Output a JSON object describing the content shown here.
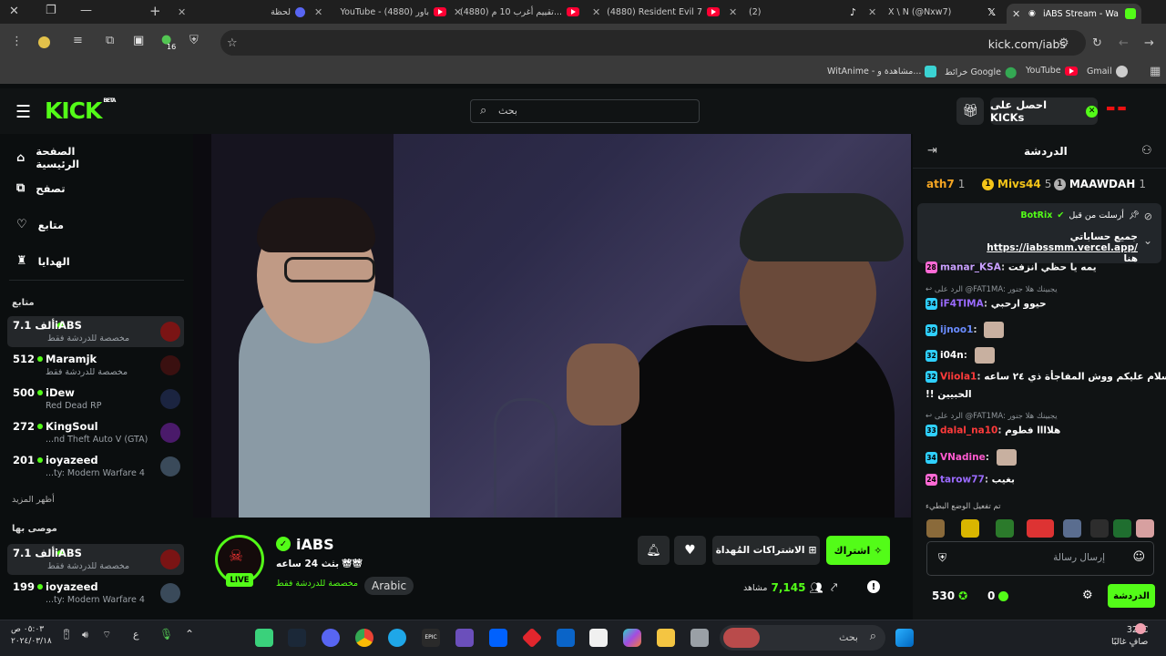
{
  "browser": {
    "tabs": [
      {
        "title": "لحظة",
        "icon": "discord-icon"
      },
      {
        "title": "YouTube - باور (4880)",
        "icon": "youtube-icon"
      },
      {
        "title": "(4880) تقييم أغرب 10 م...",
        "icon": "youtube-icon"
      },
      {
        "title": "(4880) Resident Evil 7",
        "icon": "youtube-icon"
      },
      {
        "title": "(2)",
        "icon": "tiktok-icon"
      },
      {
        "title": "X \\ N (@Nxw7)",
        "icon": "x-icon"
      },
      {
        "title": "iABS Stream - Wa",
        "icon": "kick-icon"
      }
    ],
    "url": "kick.com/iabs",
    "extension_badge": "16",
    "bookmarks": [
      {
        "label": "Gmail",
        "icon": "chrome-icon"
      },
      {
        "label": "YouTube",
        "icon": "youtube-icon"
      },
      {
        "label": "خرائط Google",
        "icon": "maps-icon"
      },
      {
        "label": "WitAnime - مشاهدة و...",
        "icon": "witanime-icon"
      }
    ]
  },
  "kick": {
    "logo": "KICK",
    "logo_badge": "BETA",
    "search_placeholder": "بحث",
    "get_kicks": "احصل على KICKs",
    "nav": [
      {
        "label": "الصفحة الرئيسية",
        "icon": "home-icon"
      },
      {
        "label": "تصفح",
        "icon": "browse-icon"
      },
      {
        "label": "متابع",
        "icon": "heart-icon"
      },
      {
        "label": "الهدايا",
        "icon": "gift-icon"
      }
    ],
    "following_heading": "متابع",
    "following": [
      {
        "name": "iABS",
        "viewers": "7.1 ألف",
        "sub": "مخصصة للدردشة فقط",
        "color": "#7a1414"
      },
      {
        "name": "Maramjk",
        "viewers": "512",
        "sub": "مخصصة للدردشة فقط",
        "color": "#3a1010"
      },
      {
        "name": "iDew",
        "viewers": "500",
        "sub": "Red Dead RP",
        "color": "#1b2440"
      },
      {
        "name": "KingSoul",
        "viewers": "272",
        "sub": "...nd Theft Auto V (GTA)",
        "color": "#4a1a6a"
      },
      {
        "name": "ioyazeed",
        "viewers": "201",
        "sub": "...ty: Modern Warfare 4",
        "color": "#3a4a5a"
      }
    ],
    "show_more": "أظهر المزيد",
    "recommended_heading": "موصى بها",
    "recommended": [
      {
        "name": "iABS",
        "viewers": "7.1 ألف",
        "sub": "مخصصة للدردشة فقط",
        "color": "#7a1414"
      },
      {
        "name": "ioyazeed",
        "viewers": "199",
        "sub": "...ty: Modern Warfare 4",
        "color": "#3a4a5a"
      }
    ],
    "channel": {
      "name": "iABS",
      "live": "LIVE",
      "title": "بثث 24 ساعه",
      "category": "مخصصة للدردشة فقط",
      "language": "Arabic",
      "subscribe": "اشتراك",
      "gift_subs": "الاشتراكات المُهداة",
      "viewers": "7,145",
      "viewers_label": "مشاهد"
    },
    "chat": {
      "title": "الدردشة",
      "leaderboard": [
        {
          "rank": "1",
          "name": "MAAWDAH",
          "count": "1",
          "color": "#d0d0d0"
        },
        {
          "rank": "1",
          "name": "Mivs44",
          "count": "5",
          "color": "#f5c518"
        },
        {
          "rank": "",
          "name": "ath7",
          "count": "1",
          "color": "#f5a623"
        }
      ],
      "pinned_by": "أرسلت من قبل",
      "pinned_user": "BotRix",
      "pinned_text": "جميع حساباتي",
      "pinned_link": "https://iabssmm.vercel.app/",
      "pinned_tail": "هنا",
      "messages": [
        {
          "badge": "28",
          "user": "manar_KSA",
          "text": "يمه يا حظي انزفت",
          "ucolor": "#c9a0ff",
          "bcolor": "#ff6ad5"
        },
        {
          "reply": "الرد على @FAT1MA: يجبينك هلا جنور"
        },
        {
          "badge": "34",
          "user": "iF4TIMA",
          "text": "حيوو ارحبي",
          "ucolor": "#9b6bff",
          "bcolor": "#2fd0ff"
        },
        {
          "badge": "39",
          "user": "ijnoo1",
          "text": "",
          "ucolor": "#6a8cff",
          "bcolor": "#2fd0ff"
        },
        {
          "badge": "32",
          "user": "i04n",
          "text": "",
          "ucolor": "#ffffff",
          "bcolor": "#2fd0ff"
        },
        {
          "badge": "32",
          "user": "Viiola1",
          "text": "السلام عليكم ووش المفاجأة ذي ٢٤ ساعه",
          "ucolor": "#ff3b3b",
          "bcolor": "#2fd0ff"
        },
        {
          "cont": "!! الحبيين"
        },
        {
          "reply": "الرد على @FAT1MA: يجبينك هلا جنور"
        },
        {
          "badge": "33",
          "user": "dalal_na10",
          "text": "هلاااا فطوم",
          "ucolor": "#ff3b3b",
          "bcolor": "#2fd0ff"
        },
        {
          "badge": "34",
          "user": "VNadine",
          "text": "",
          "ucolor": "#ff5ad0",
          "bcolor": "#2fd0ff"
        },
        {
          "badge": "24",
          "user": "tarow77",
          "text": "بغيب",
          "ucolor": "#9b6bff",
          "bcolor": "#ff6ad5"
        }
      ],
      "emote_mode": "تم تفعيل الوضع البطيء",
      "input_placeholder": "إرسال رسالة",
      "points": "530",
      "kicks": "0",
      "send": "الدردشة"
    }
  },
  "taskbar": {
    "search": "بحث",
    "time": "٠٥:٠٣ ص",
    "date": "٢٠٢٤/٠٣/١٨",
    "temperature": "32°C",
    "weather": "صافٍ غالبًا"
  }
}
